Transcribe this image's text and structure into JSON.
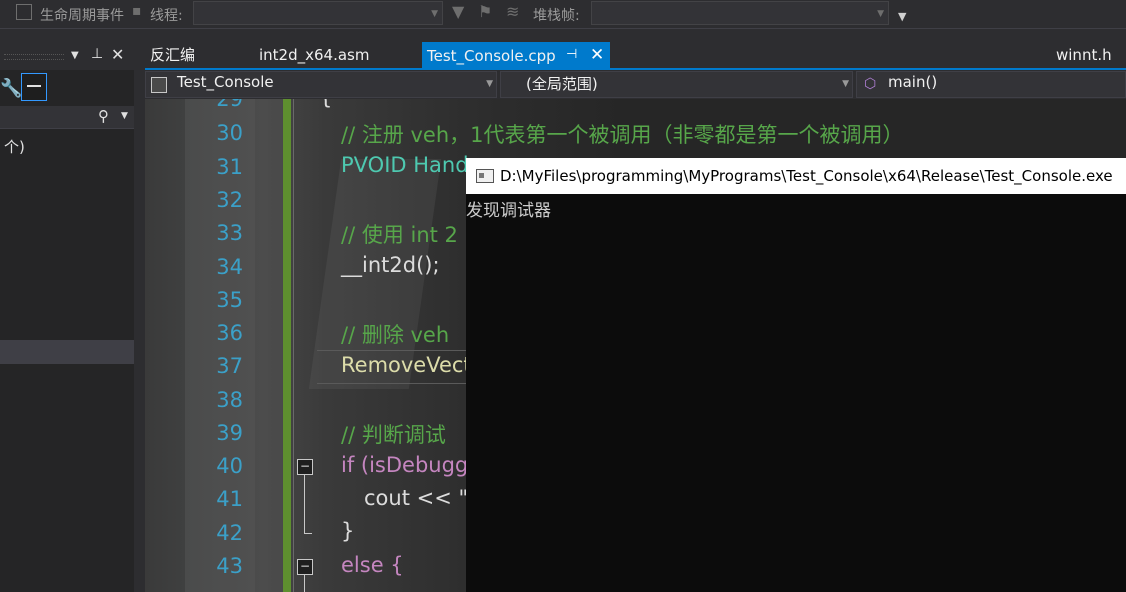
{
  "toolbar": {
    "lifecycle_label": "生命周期事件",
    "thread_label": "线程:",
    "stackframe_label": "堆栈帧:"
  },
  "tabs": [
    {
      "label": "反汇编"
    },
    {
      "label": "int2d_x64.asm"
    },
    {
      "label": "Test_Console.cpp",
      "active": true
    },
    {
      "label": "winnt.h"
    }
  ],
  "left_panel": {
    "item_text": "个)"
  },
  "navbar": {
    "project": "Test_Console",
    "scope": "(全局范围)",
    "member": "main()"
  },
  "editor": {
    "lines": [
      {
        "num": "29",
        "text": "{"
      },
      {
        "num": "30",
        "text": "// 注册 veh，1代表第一个被调用（非零都是第一个被调用）"
      },
      {
        "num": "31",
        "text": "PVOID Hand"
      },
      {
        "num": "32",
        "text": ""
      },
      {
        "num": "33",
        "text": "// 使用 int 2"
      },
      {
        "num": "34",
        "text": "__int2d();"
      },
      {
        "num": "35",
        "text": ""
      },
      {
        "num": "36",
        "text": "// 删除 veh"
      },
      {
        "num": "37",
        "text": "RemoveVect"
      },
      {
        "num": "38",
        "text": ""
      },
      {
        "num": "39",
        "text": "// 判断调试"
      },
      {
        "num": "40",
        "text": "if (isDebugg"
      },
      {
        "num": "41",
        "text": "cout << \""
      },
      {
        "num": "42",
        "text": "}"
      },
      {
        "num": "43",
        "text": "else {"
      }
    ]
  },
  "console": {
    "title": "D:\\MyFiles\\programming\\MyPrograms\\Test_Console\\x64\\Release\\Test_Console.exe",
    "output": "发现调试器"
  },
  "colors": {
    "accent": "#007acc",
    "comment": "#57a64a",
    "line_number": "#3ba0c8",
    "keyword": "#c586c0"
  }
}
